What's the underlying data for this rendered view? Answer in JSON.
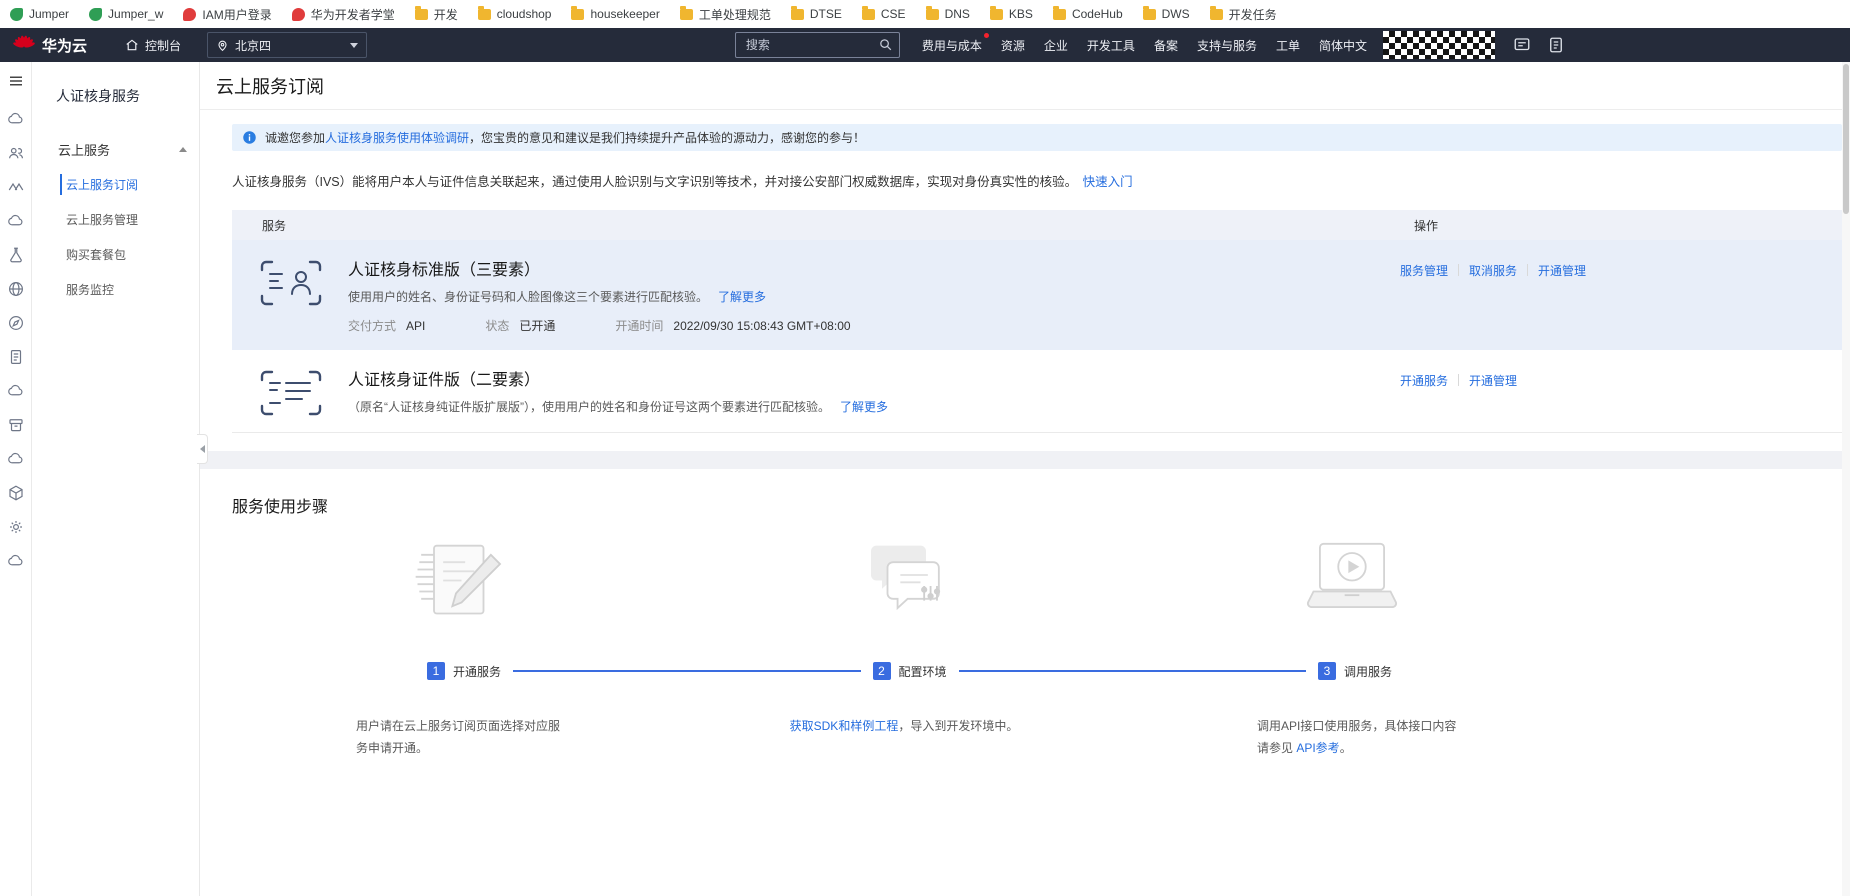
{
  "bookmarks": {
    "items": [
      {
        "label": "Jumper",
        "icon": "leaf"
      },
      {
        "label": "Jumper_w",
        "icon": "leaf"
      },
      {
        "label": "IAM用户登录",
        "icon": "flame"
      },
      {
        "label": "华为开发者学堂",
        "icon": "flame"
      },
      {
        "label": "开发",
        "icon": "folder"
      },
      {
        "label": "cloudshop",
        "icon": "folder"
      },
      {
        "label": "housekeeper",
        "icon": "folder"
      },
      {
        "label": "工单处理规范",
        "icon": "folder"
      },
      {
        "label": "DTSE",
        "icon": "folder"
      },
      {
        "label": "CSE",
        "icon": "folder"
      },
      {
        "label": "DNS",
        "icon": "folder"
      },
      {
        "label": "KBS",
        "icon": "folder"
      },
      {
        "label": "CodeHub",
        "icon": "folder"
      },
      {
        "label": "DWS",
        "icon": "folder"
      },
      {
        "label": "开发任务",
        "icon": "folder"
      }
    ]
  },
  "header": {
    "brand": "华为云",
    "console_label": "控制台",
    "region": "北京四",
    "search_placeholder": "搜索",
    "menu": [
      "费用与成本",
      "资源",
      "企业",
      "开发工具",
      "备案",
      "支持与服务",
      "工单",
      "简体中文"
    ]
  },
  "rail": {
    "icons": [
      {
        "name": "cloud-icon",
        "sym": "cloud"
      },
      {
        "name": "users-icon",
        "sym": "users"
      },
      {
        "name": "waves-icon",
        "sym": "waves"
      },
      {
        "name": "cloud-icon",
        "sym": "cloud"
      },
      {
        "name": "flask-icon",
        "sym": "flask"
      },
      {
        "name": "globe-icon",
        "sym": "globe"
      },
      {
        "name": "compass-icon",
        "sym": "compass"
      },
      {
        "name": "document-icon",
        "sym": "doc"
      },
      {
        "name": "cloud-icon",
        "sym": "cloud"
      },
      {
        "name": "archive-icon",
        "sym": "archive"
      },
      {
        "name": "cloud-icon",
        "sym": "cloud"
      },
      {
        "name": "box-icon",
        "sym": "box"
      },
      {
        "name": "gear-icon",
        "sym": "gear"
      },
      {
        "name": "cloud-icon",
        "sym": "cloud"
      }
    ]
  },
  "sidebar": {
    "title": "人证核身服务",
    "group_label": "云上服务",
    "items": [
      {
        "label": "云上服务订阅",
        "active": true
      },
      {
        "label": "云上服务管理",
        "active": false
      },
      {
        "label": "购买套餐包",
        "active": false
      },
      {
        "label": "服务监控",
        "active": false
      }
    ]
  },
  "main": {
    "page_title": "云上服务订阅",
    "banner": {
      "prefix": "诚邀您参加",
      "link": "人证核身服务使用体验调研",
      "suffix": "，您宝贵的意见和建议是我们持续提升产品体验的源动力，感谢您的参与！"
    },
    "intro": {
      "text": "人证核身服务（IVS）能将用户本人与证件信息关联起来，通过使用人脸识别与文字识别等技术，并对接公安部门权威数据库，实现对身份真实性的核验。",
      "link": "快速入门"
    },
    "table": {
      "col_service": "服务",
      "col_action": "操作",
      "rows": [
        {
          "title": "人证核身标准版（三要素）",
          "desc": "使用用户的姓名、身份证号码和人脸图像这三个要素进行匹配核验。",
          "more": "了解更多",
          "delivery_label": "交付方式",
          "delivery_value": "API",
          "status_label": "状态",
          "status_value": "已开通",
          "time_label": "开通时间",
          "time_value": "2022/09/30 15:08:43 GMT+08:00",
          "actions": [
            "服务管理",
            "取消服务",
            "开通管理"
          ]
        },
        {
          "title": "人证核身证件版（二要素）",
          "desc": "（原名“人证核身纯证件版扩展版”），使用用户的姓名和身份证号这两个要素进行匹配核验。",
          "more": "了解更多",
          "actions": [
            "开通服务",
            "开通管理"
          ]
        }
      ]
    },
    "steps": {
      "title": "服务使用步骤",
      "items": [
        {
          "num": "1",
          "label": "开通服务"
        },
        {
          "num": "2",
          "label": "配置环境"
        },
        {
          "num": "3",
          "label": "调用服务"
        }
      ],
      "descs": [
        {
          "parts": [
            {
              "text": "用户请在云上服务订阅页面选择对应服务申请开通。",
              "link": false
            }
          ]
        },
        {
          "parts": [
            {
              "text": "获取SDK和样例工程",
              "link": true
            },
            {
              "text": "，导入到开发环境中。",
              "link": false
            }
          ]
        },
        {
          "parts": [
            {
              "text": "调用API接口使用服务，具体接口内容请参见 ",
              "link": false
            },
            {
              "text": "API参考",
              "link": true
            },
            {
              "text": "。",
              "link": false
            }
          ]
        }
      ]
    }
  },
  "colors": {
    "accent": "#256dde",
    "header_bg": "#252b3a",
    "selected_row_bg": "#e8eef9",
    "banner_bg": "#e7f1fc",
    "step_blue": "#3a6ce0",
    "notification_dot": "#f5222d"
  }
}
